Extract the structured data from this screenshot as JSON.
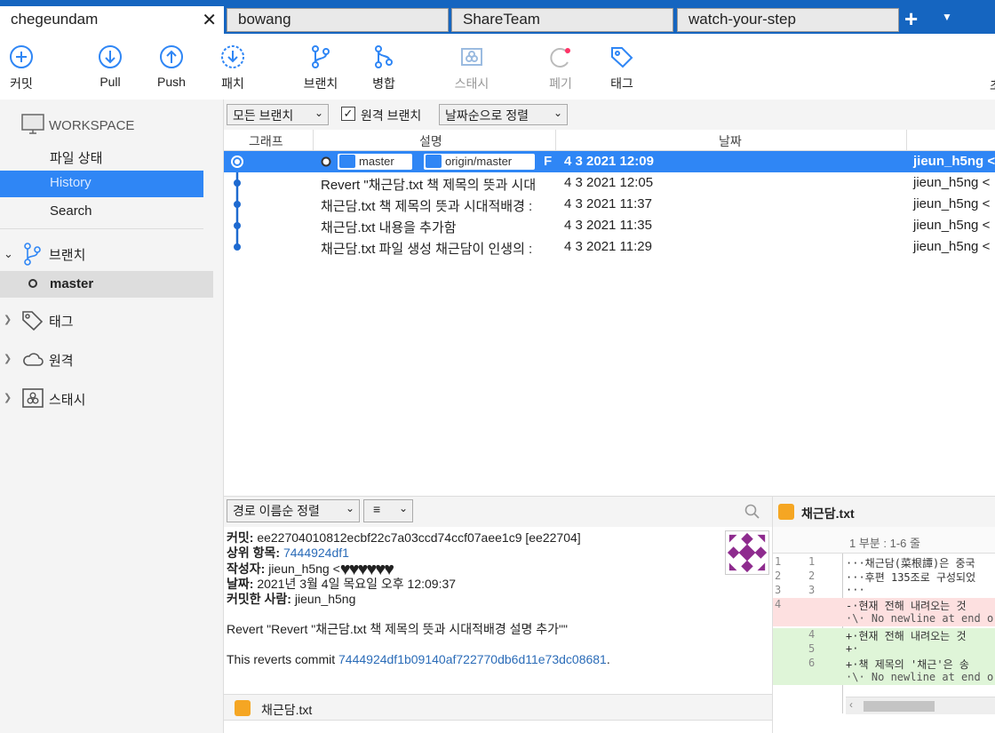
{
  "tabs": [
    {
      "label": "chegeundam",
      "active": true
    },
    {
      "label": "bowang"
    },
    {
      "label": "ShareTeam"
    },
    {
      "label": "watch-your-step"
    }
  ],
  "toolbar": {
    "commit": "커밋",
    "pull": "Pull",
    "push": "Push",
    "patch": "패치",
    "branch": "브랜치",
    "merge": "병합",
    "stash": "스태시",
    "discard": "폐기",
    "tag": "태그",
    "cut": "초"
  },
  "sidebar": {
    "workspace": "WORKSPACE",
    "items": [
      "파일 상태",
      "History",
      "Search"
    ],
    "groups": {
      "branches": "브랜치",
      "tags": "태그",
      "remotes": "원격",
      "stash": "스태시"
    },
    "current_branch": "master"
  },
  "filter": {
    "branches": "모든 브랜치",
    "remote_branches": "원격 브랜치",
    "sort": "날짜순으로 정렬"
  },
  "table": {
    "headers": {
      "graph": "그래프",
      "description": "설명",
      "date": "날짜"
    },
    "rows": [
      {
        "desc": "F",
        "date": "4 3 2021 12:09",
        "author": "jieun_h5ng <",
        "tags": [
          "master",
          "origin/master"
        ]
      },
      {
        "desc": "Revert \"채근담.txt 책 제목의 뜻과 시대",
        "date": "4 3 2021 12:05",
        "author": "jieun_h5ng <"
      },
      {
        "desc": "채근담.txt 책 제목의 뜻과 시대적배경 :",
        "date": "4 3 2021 11:37",
        "author": "jieun_h5ng <"
      },
      {
        "desc": "채근담.txt 내용을 추가함",
        "date": "4 3 2021 11:35",
        "author": "jieun_h5ng <"
      },
      {
        "desc": "채근담.txt 파일 생성 채근담이 인생의 :",
        "date": "4 3 2021 11:29",
        "author": "jieun_h5ng <"
      }
    ]
  },
  "lower": {
    "sort_label": "경로 이름순 정렬",
    "list_icon": "≡",
    "commit_label": "커밋:",
    "commit_value": "ee22704010812ecbf22c7a03ccd74ccf07aee1c9 [ee22704]",
    "parent_label": "상위 항목:",
    "parent_value": "7444924df1",
    "author_label": "작성자:",
    "author_value": "jieun_h5ng <",
    "date_label": "날짜:",
    "date_value": "2021년 3월 4일 목요일 오후 12:09:37",
    "committer_label": "커밋한 사람:",
    "committer_value": "jieun_h5ng",
    "message": "Revert \"Revert \"채근담.txt 책 제목의 뜻과 시대적배경 설명 추가\"\"",
    "reverts_prefix": "This reverts commit ",
    "reverts_hash": "7444924df1b09140af722770db6d11e73dc08681",
    "reverts_suffix": ".",
    "file_name": "채근담.txt"
  },
  "diff": {
    "file": "채근담.txt",
    "hunk": "1 부분 : 1-6 줄",
    "lines": [
      {
        "n1": "1",
        "n2": "1",
        "type": "ctx",
        "text": "···채근담(菜根譚)은 중국"
      },
      {
        "n1": "2",
        "n2": "2",
        "type": "ctx",
        "text": "···후편 135조로 구성되었"
      },
      {
        "n1": "3",
        "n2": "3",
        "type": "ctx",
        "text": "···"
      },
      {
        "n1": "4",
        "n2": "",
        "type": "del",
        "text": "-·현재 전해 내려오는 것"
      },
      {
        "n1": "",
        "n2": "",
        "type": "meta",
        "text": "·\\· No newline at end o"
      },
      {
        "n1": "",
        "n2": "4",
        "type": "add",
        "text": "+·현재 전해 내려오는 것"
      },
      {
        "n1": "",
        "n2": "5",
        "type": "add",
        "text": "+·"
      },
      {
        "n1": "",
        "n2": "6",
        "type": "add",
        "text": "+·책 제목의 '채근'은 송"
      },
      {
        "n1": "",
        "n2": "",
        "type": "meta",
        "text": "·\\· No newline at end o"
      }
    ]
  },
  "colors": {
    "accent": "#2f86f5",
    "tabbar": "#1565c0",
    "file_icon": "#f5a623"
  }
}
